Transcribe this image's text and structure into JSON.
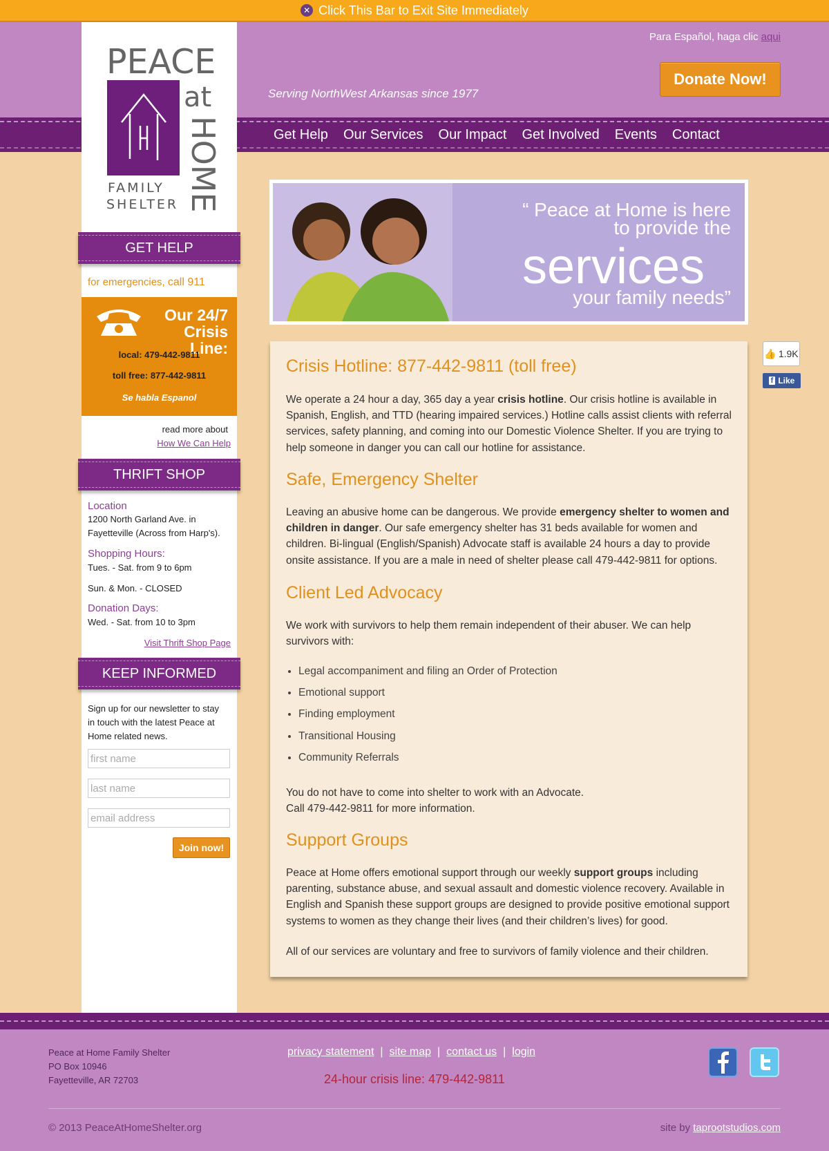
{
  "exit_bar": {
    "icon": "close-circle-icon",
    "label": "Click This Bar to Exit Site Immediately"
  },
  "header": {
    "espanol_text": "Para Español, haga clic",
    "espanol_link": "aqui",
    "donate_label": "Donate Now!",
    "tagline": "Serving NorthWest Arkansas since 1977"
  },
  "logo": {
    "line1": "PEACE",
    "at": "at",
    "home": "HOME",
    "line3": "FAMILY",
    "line4": "SHELTER"
  },
  "nav": [
    "Get Help",
    "Our Services",
    "Our Impact",
    "Get Involved",
    "Events",
    "Contact"
  ],
  "sidebar": {
    "get_help": {
      "heading": "GET HELP",
      "emergency_text": "for emergencies,",
      "emergency_call": "call 911",
      "crisis_title": "Our 24/7 Crisis Line:",
      "local": "local: 479-442-9811",
      "toll_free": "toll free: 877-442-9811",
      "spanish": "Se habla Espanol",
      "read_more": "read more about",
      "read_more_link": "How We Can Help"
    },
    "thrift": {
      "heading": "THRIFT SHOP",
      "location_label": "Location",
      "address_line1": "1200 North Garland Ave. in",
      "address_line2": "Fayetteville (Across from Harp's).",
      "hours_label": "Shopping Hours:",
      "hours_1": "Tues. - Sat. from 9 to 6pm",
      "hours_2": "Sun. & Mon. - CLOSED",
      "donation_label": "Donation Days:",
      "donation_hours": "Wed. - Sat. from 10 to 3pm",
      "link": "Visit Thrift Shop Page"
    },
    "newsletter": {
      "heading": "KEEP INFORMED",
      "text_line1": "Sign up for our newsletter to stay",
      "text_line2": "in touch with the latest Peace at",
      "text_line3": "Home related news.",
      "first_placeholder": "first name",
      "last_placeholder": "last name",
      "email_placeholder": "email address",
      "join_label": "Join now!"
    }
  },
  "banner": {
    "quote_line1": "“ Peace at Home is here",
    "quote_line2": "to provide the",
    "quote_big": "services",
    "quote_line3": "your family needs”"
  },
  "social_like": {
    "count": "1.9K",
    "like_label": "Like"
  },
  "content": {
    "h1": "Crisis Hotline: 877-442-9811 (toll free)",
    "p1_a": "We operate a 24 hour a day, 365 day a year ",
    "p1_b": "crisis hotline",
    "p1_c": ". Our crisis hotline is available in Spanish, English, and TTD (hearing impaired services.) Hotline calls assist clients with referral services, safety planning, and coming into our Domestic Violence Shelter.  If you are trying to help someone in danger you can call our hotline for assistance.",
    "h2": "Safe, Emergency Shelter",
    "p2_a": "Leaving an abusive home can be dangerous. We provide ",
    "p2_b": "emergency shelter to women and children in danger",
    "p2_c": ". Our safe emergency shelter has 31 beds available for women and children. Bi-lingual (English/Spanish) Advocate staff is available 24 hours a day to provide onsite assistance. If you are a male in need of shelter please call 479-442-9811 for options.",
    "h3": "Client Led Advocacy",
    "p3": "We work with survivors to help them remain independent of their abuser.  We can help survivors with:",
    "list": [
      "Legal accompaniment and filing an Order of Protection",
      "Emotional support",
      "Finding employment",
      "Transitional Housing",
      "Community Referrals"
    ],
    "p4_line1": "You do not have to come into shelter to work with an Advocate.",
    "p4_line2": "Call 479-442-9811 for more information.",
    "h4": "Support Groups",
    "p5_a": "Peace at Home offers emotional support through our weekly ",
    "p5_b": "support groups",
    "p5_c": " including parenting, substance abuse, and sexual assault and domestic violence recovery.  Available in English and Spanish these support groups are designed to provide positive emotional support systems to women as they change their lives (and their children’s lives) for good.",
    "p6": "All of our services are voluntary and free to survivors of family violence and their children."
  },
  "footer": {
    "addr1": "Peace at Home Family Shelter",
    "addr2": "PO Box 10946",
    "addr3": "Fayetteville, AR 72703",
    "links": [
      "privacy statement",
      "site map",
      "contact us",
      "login"
    ],
    "crisis_line": "24-hour crisis line: 479-442-9811",
    "copyright": "© 2013 PeaceAtHomeShelter.org",
    "site_by": "site by",
    "site_by_link": "taprootstudios.com"
  },
  "colors": {
    "purple": "#6d2073",
    "lilac": "#c087c2",
    "orange": "#e58c0f",
    "peach": "#f3d3a5"
  }
}
